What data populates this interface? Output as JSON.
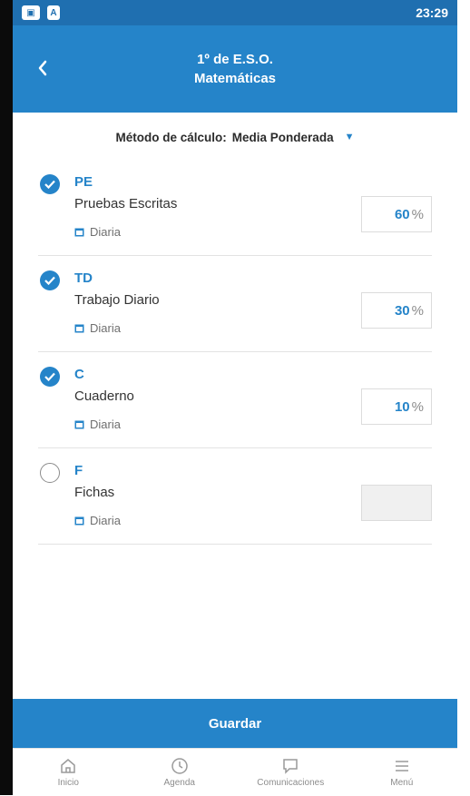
{
  "status_bar": {
    "time": "23:29",
    "icons": [
      "app-notification-icon",
      "a-icon"
    ]
  },
  "header": {
    "title": "1º de E.S.O.",
    "subtitle": "Matemáticas"
  },
  "calc_method": {
    "label": "Método de cálculo:",
    "value": "Media Ponderada"
  },
  "items": [
    {
      "code": "PE",
      "name": "Pruebas Escritas",
      "frequency": "Diaria",
      "checked": true,
      "percent": "60",
      "unit": "%"
    },
    {
      "code": "TD",
      "name": "Trabajo Diario",
      "frequency": "Diaria",
      "checked": true,
      "percent": "30",
      "unit": "%"
    },
    {
      "code": "C",
      "name": "Cuaderno",
      "frequency": "Diaria",
      "checked": true,
      "percent": "10",
      "unit": "%"
    },
    {
      "code": "F",
      "name": "Fichas",
      "frequency": "Diaria",
      "checked": false,
      "percent": "",
      "unit": ""
    }
  ],
  "save_label": "Guardar",
  "bottom_nav": [
    {
      "label": "Inicio",
      "icon": "home-icon"
    },
    {
      "label": "Agenda",
      "icon": "clock-icon"
    },
    {
      "label": "Comunicaciones",
      "icon": "chat-icon"
    },
    {
      "label": "Menú",
      "icon": "menu-icon"
    }
  ],
  "colors": {
    "accent": "#2584c9",
    "status_bar": "#1f6fb0"
  }
}
